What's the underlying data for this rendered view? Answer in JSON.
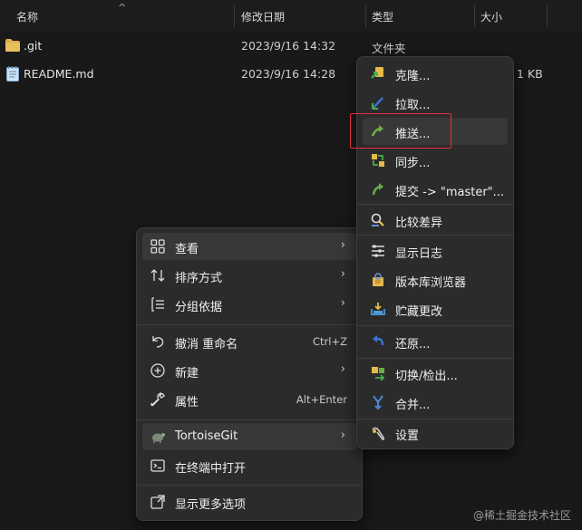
{
  "columns": {
    "name": "名称",
    "date": "修改日期",
    "type": "类型",
    "size": "大小"
  },
  "files": [
    {
      "name": ".git",
      "date": "2023/9/16 14:32",
      "type": "文件夹",
      "size": ""
    },
    {
      "name": "README.md",
      "date": "2023/9/16 14:28",
      "type": "",
      "size": "1 KB"
    }
  ],
  "context_menu": {
    "items": [
      {
        "label": "查看",
        "shortcut": "",
        "arrow": "›"
      },
      {
        "label": "排序方式",
        "shortcut": "",
        "arrow": "›"
      },
      {
        "label": "分组依据",
        "shortcut": "",
        "arrow": "›"
      },
      {
        "label": "撤消 重命名",
        "shortcut": "Ctrl+Z",
        "arrow": ""
      },
      {
        "label": "新建",
        "shortcut": "",
        "arrow": "›"
      },
      {
        "label": "属性",
        "shortcut": "Alt+Enter",
        "arrow": ""
      },
      {
        "label": "TortoiseGit",
        "shortcut": "",
        "arrow": "›"
      },
      {
        "label": "在终端中打开",
        "shortcut": "",
        "arrow": ""
      },
      {
        "label": "显示更多选项",
        "shortcut": "",
        "arrow": ""
      }
    ]
  },
  "tortoise_menu": {
    "items": [
      {
        "label": "克隆..."
      },
      {
        "label": "拉取..."
      },
      {
        "label": "推送..."
      },
      {
        "label": "同步..."
      },
      {
        "label": "提交 -> \"master\"..."
      },
      {
        "label": "比较差异"
      },
      {
        "label": "显示日志"
      },
      {
        "label": "版本库浏览器"
      },
      {
        "label": "贮藏更改"
      },
      {
        "label": "还原..."
      },
      {
        "label": "切换/检出..."
      },
      {
        "label": "合并..."
      },
      {
        "label": "设置"
      }
    ]
  },
  "watermark": "@稀土掘金技术社区",
  "colors": {
    "background": "#191919",
    "menu": "#2b2b2b",
    "highlight_box": "#e0313a"
  }
}
